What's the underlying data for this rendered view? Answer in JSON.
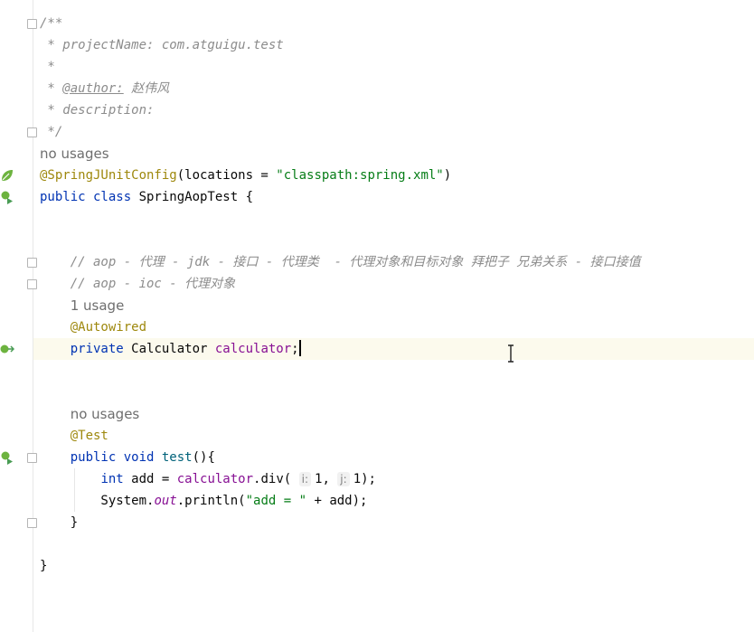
{
  "editor": {
    "lines": [
      {
        "segments": [
          {
            "text": "/**",
            "style": "cm"
          }
        ]
      },
      {
        "segments": [
          {
            "text": " * projectName: com.atguigu.test",
            "style": "cm"
          }
        ]
      },
      {
        "segments": [
          {
            "text": " *",
            "style": "cm"
          }
        ]
      },
      {
        "segments": [
          {
            "text": " * ",
            "style": "cm"
          },
          {
            "text": "@author:",
            "style": "cm-tag"
          },
          {
            "text": " 赵伟风",
            "style": "cm"
          }
        ]
      },
      {
        "segments": [
          {
            "text": " * description:",
            "style": "cm"
          }
        ]
      },
      {
        "segments": [
          {
            "text": " */",
            "style": "cm"
          }
        ]
      },
      {
        "segments": [
          {
            "text": "no usages",
            "style": "hint"
          }
        ]
      },
      {
        "segments": [
          {
            "text": "@SpringJUnitConfig",
            "style": "ann"
          },
          {
            "text": "(locations = ",
            "style": "plain"
          },
          {
            "text": "\"classpath:spring.xml\"",
            "style": "str"
          },
          {
            "text": ")",
            "style": "plain"
          }
        ]
      },
      {
        "segments": [
          {
            "text": "public class ",
            "style": "kw"
          },
          {
            "text": "SpringAopTest {",
            "style": "plain"
          }
        ]
      },
      {
        "segments": []
      },
      {
        "segments": []
      },
      {
        "segments": [
          {
            "text": "    // aop - 代理 - jdk - 接口 - 代理类  - 代理对象和目标对象 拜把子 兄弟关系 - 接口接值",
            "style": "cm"
          }
        ]
      },
      {
        "segments": [
          {
            "text": "    // aop - ioc - 代理对象",
            "style": "cm"
          }
        ]
      },
      {
        "segments": [
          {
            "text": "    ",
            "style": "plain"
          },
          {
            "text": "1 usage",
            "style": "hint"
          }
        ]
      },
      {
        "segments": [
          {
            "text": "    ",
            "style": "plain"
          },
          {
            "text": "@Autowired",
            "style": "ann"
          }
        ]
      },
      {
        "segments": [
          {
            "text": "    ",
            "style": "plain"
          },
          {
            "text": "private ",
            "style": "kw"
          },
          {
            "text": "Calculator ",
            "style": "plain"
          },
          {
            "text": "calculator",
            "style": "fld"
          },
          {
            "text": ";",
            "style": "plain"
          },
          {
            "text": "",
            "style": "caret"
          }
        ]
      },
      {
        "segments": []
      },
      {
        "segments": []
      },
      {
        "segments": [
          {
            "text": "    ",
            "style": "plain"
          },
          {
            "text": "no usages",
            "style": "hint"
          }
        ]
      },
      {
        "segments": [
          {
            "text": "    ",
            "style": "plain"
          },
          {
            "text": "@Test",
            "style": "ann"
          }
        ]
      },
      {
        "segments": [
          {
            "text": "    ",
            "style": "plain"
          },
          {
            "text": "public void ",
            "style": "kw"
          },
          {
            "text": "test",
            "style": "fn"
          },
          {
            "text": "(){",
            "style": "plain"
          }
        ]
      },
      {
        "segments": [
          {
            "text": "        ",
            "style": "plain"
          },
          {
            "text": "int ",
            "style": "kw"
          },
          {
            "text": "add = ",
            "style": "plain"
          },
          {
            "text": "calculator",
            "style": "fld"
          },
          {
            "text": ".div( ",
            "style": "plain"
          },
          {
            "text": "i:",
            "style": "hintbox"
          },
          {
            "text": "1",
            "style": "plain"
          },
          {
            "text": ", ",
            "style": "plain"
          },
          {
            "text": "j:",
            "style": "hintbox"
          },
          {
            "text": "1",
            "style": "plain"
          },
          {
            "text": ");",
            "style": "plain"
          }
        ]
      },
      {
        "segments": [
          {
            "text": "        System.",
            "style": "plain"
          },
          {
            "text": "out",
            "style": "fld-ital"
          },
          {
            "text": ".println(",
            "style": "plain"
          },
          {
            "text": "\"add = \"",
            "style": "str"
          },
          {
            "text": " + add);",
            "style": "plain"
          }
        ]
      },
      {
        "segments": [
          {
            "text": "    }",
            "style": "plain"
          }
        ]
      },
      {
        "segments": []
      },
      {
        "segments": [
          {
            "text": "}",
            "style": "plain"
          }
        ]
      }
    ],
    "current_line_index": 15,
    "fold_markers": [
      0,
      5,
      11,
      12,
      20,
      23
    ],
    "gutter_icons": [
      {
        "line": 7,
        "icon": "spring-bean-icon"
      },
      {
        "line": 8,
        "icon": "run-test-class-icon"
      },
      {
        "line": 15,
        "icon": "autowired-bean-icon"
      },
      {
        "line": 20,
        "icon": "run-test-method-icon"
      }
    ]
  }
}
